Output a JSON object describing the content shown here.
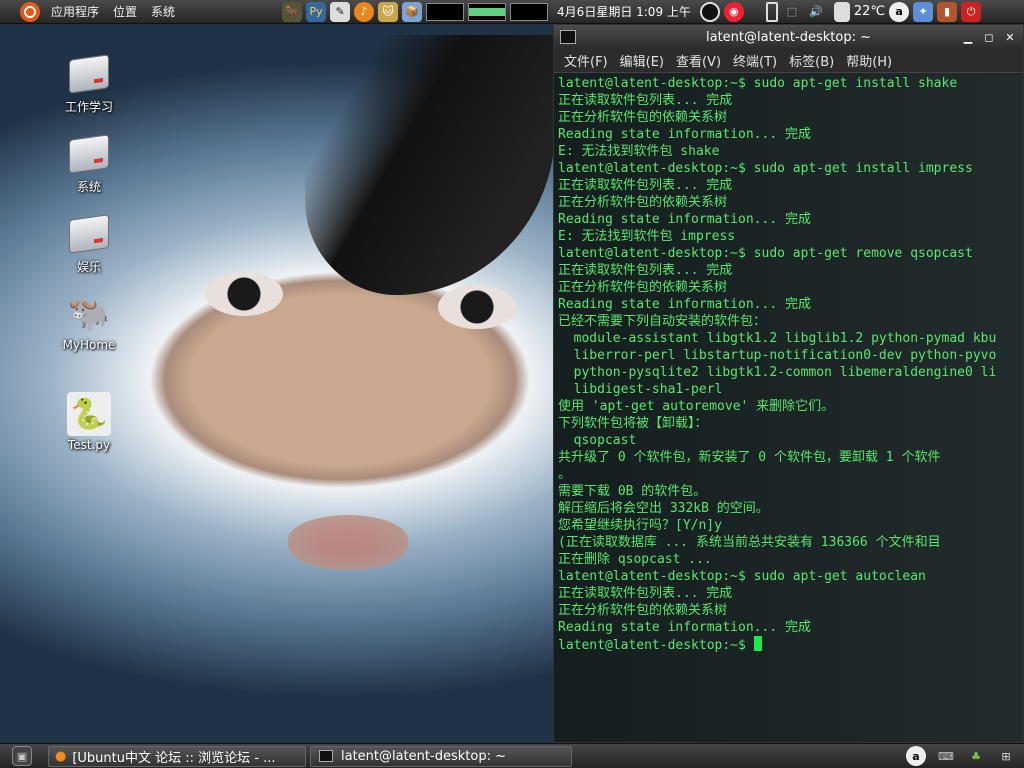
{
  "top_panel": {
    "menus": [
      "应用程序",
      "位置",
      "系统"
    ],
    "clock": "4月6日星期日  1:09 上午",
    "weather": "22℃"
  },
  "desktop": {
    "icons": [
      {
        "label": "工作学习"
      },
      {
        "label": "系统"
      },
      {
        "label": "娱乐"
      },
      {
        "label": "MyHome"
      },
      {
        "label": "Test.py"
      }
    ]
  },
  "terminal": {
    "title": "latent@latent-desktop: ~",
    "menu": [
      "文件(F)",
      "编辑(E)",
      "查看(V)",
      "终端(T)",
      "标签(B)",
      "帮助(H)"
    ],
    "lines": [
      "latent@latent-desktop:~$ sudo apt-get install shake",
      "正在读取软件包列表... 完成",
      "正在分析软件包的依赖关系树",
      "Reading state information... 完成",
      "E: 无法找到软件包 shake",
      "latent@latent-desktop:~$ sudo apt-get install impress",
      "正在读取软件包列表... 完成",
      "正在分析软件包的依赖关系树",
      "Reading state information... 完成",
      "E: 无法找到软件包 impress",
      "latent@latent-desktop:~$ sudo apt-get remove qsopcast",
      "正在读取软件包列表... 完成",
      "正在分析软件包的依赖关系树",
      "Reading state information... 完成",
      "已经不需要下列自动安装的软件包：",
      "  module-assistant libgtk1.2 libglib1.2 python-pymad kbu",
      "  liberror-perl libstartup-notification0-dev python-pyvo",
      "  python-pysqlite2 libgtk1.2-common libemeraldengine0 li",
      "  libdigest-sha1-perl",
      "使用 'apt-get autoremove' 来删除它们。",
      "下列软件包将被【卸载】：",
      "  qsopcast",
      "共升级了 0 个软件包，新安装了 0 个软件包，要卸载 1 个软件",
      "。",
      "需要下载 0B 的软件包。",
      "解压缩后将会空出 332kB 的空间。",
      "您希望继续执行吗？[Y/n]y",
      "(正在读取数据库 ... 系统当前总共安装有 136366 个文件和目",
      "正在删除 qsopcast ...",
      "latent@latent-desktop:~$ sudo apt-get autoclean",
      "正在读取软件包列表... 完成",
      "正在分析软件包的依赖关系树",
      "Reading state information... 完成"
    ],
    "prompt": "latent@latent-desktop:~$ "
  },
  "taskbar": {
    "tasks": [
      {
        "label": "[Ubuntu中文 论坛 :: 浏览论坛 - ..."
      },
      {
        "label": "latent@latent-desktop: ~"
      }
    ]
  },
  "colors": {
    "terminal_text": "#58e86c",
    "cursor": "#1fe84f",
    "panel": "#333333"
  }
}
